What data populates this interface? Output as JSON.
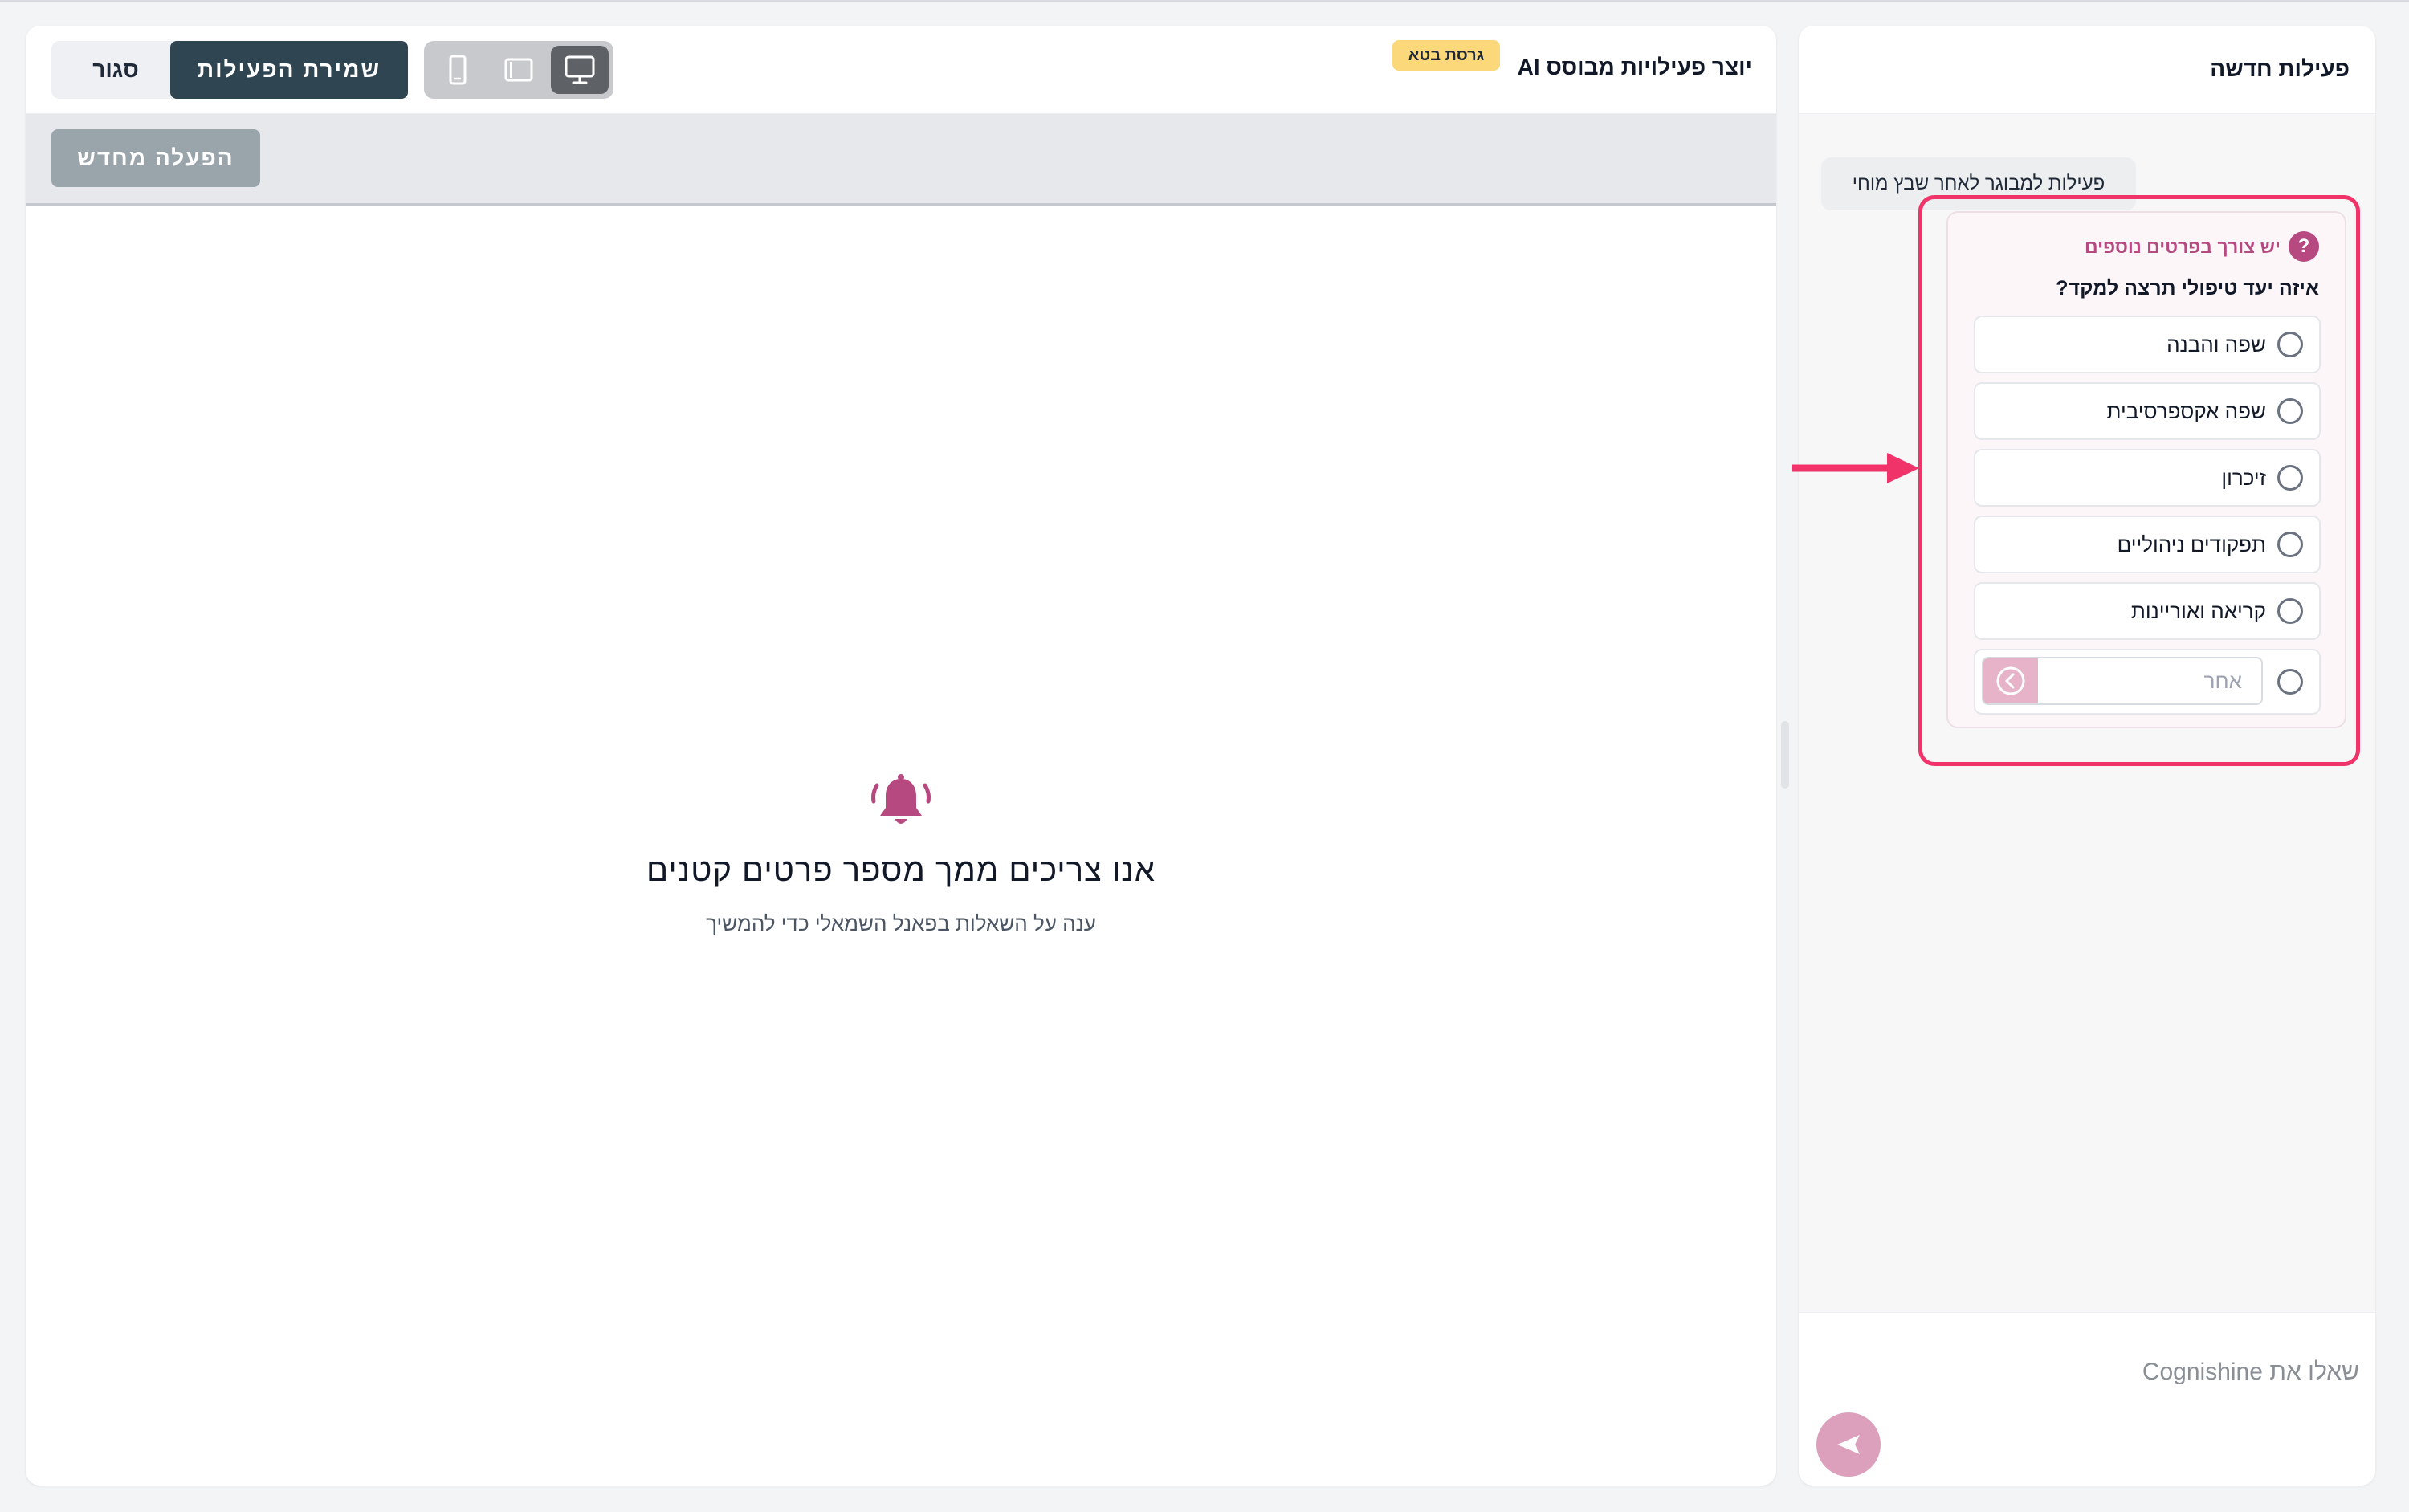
{
  "colors": {
    "accent_pink": "#b64980",
    "highlight_red": "#f0346a",
    "save_button": "#2f4551",
    "beta_badge": "#fbd97a"
  },
  "header": {
    "close_label": "סגור",
    "save_label": "שמירת הפעילות",
    "app_title": "יוצר פעילויות מבוסס AI",
    "beta_badge": "גרסת בטא",
    "device_modes": [
      "mobile-icon",
      "tablet-icon",
      "desktop-icon"
    ],
    "active_device": "desktop"
  },
  "toolbar": {
    "rerun_label": "הפעלה מחדש"
  },
  "empty_state": {
    "icon": "bell-icon",
    "title": "אנו צריכים ממך מספר פרטים קטנים",
    "subtitle": "ענה על השאלות בפאנל השמאלי כדי להמשיך"
  },
  "chat": {
    "title": "פעילות חדשה",
    "user_message": "פעילות למבוגר לאחר שבץ מוחי",
    "input_placeholder": "שאלו את Cognishine",
    "send_icon": "send-icon"
  },
  "question": {
    "header": "יש צורך בפרטים נוספים",
    "title": "איזה יעד טיפולי תרצה למקד?",
    "options": [
      {
        "label": "שפה והבנה"
      },
      {
        "label": "שפה אקספרסיבית"
      },
      {
        "label": "זיכרון"
      },
      {
        "label": "תפקודים ניהוליים"
      },
      {
        "label": "קריאה ואוריינות"
      }
    ],
    "other_placeholder": "אחר",
    "selected": null
  }
}
